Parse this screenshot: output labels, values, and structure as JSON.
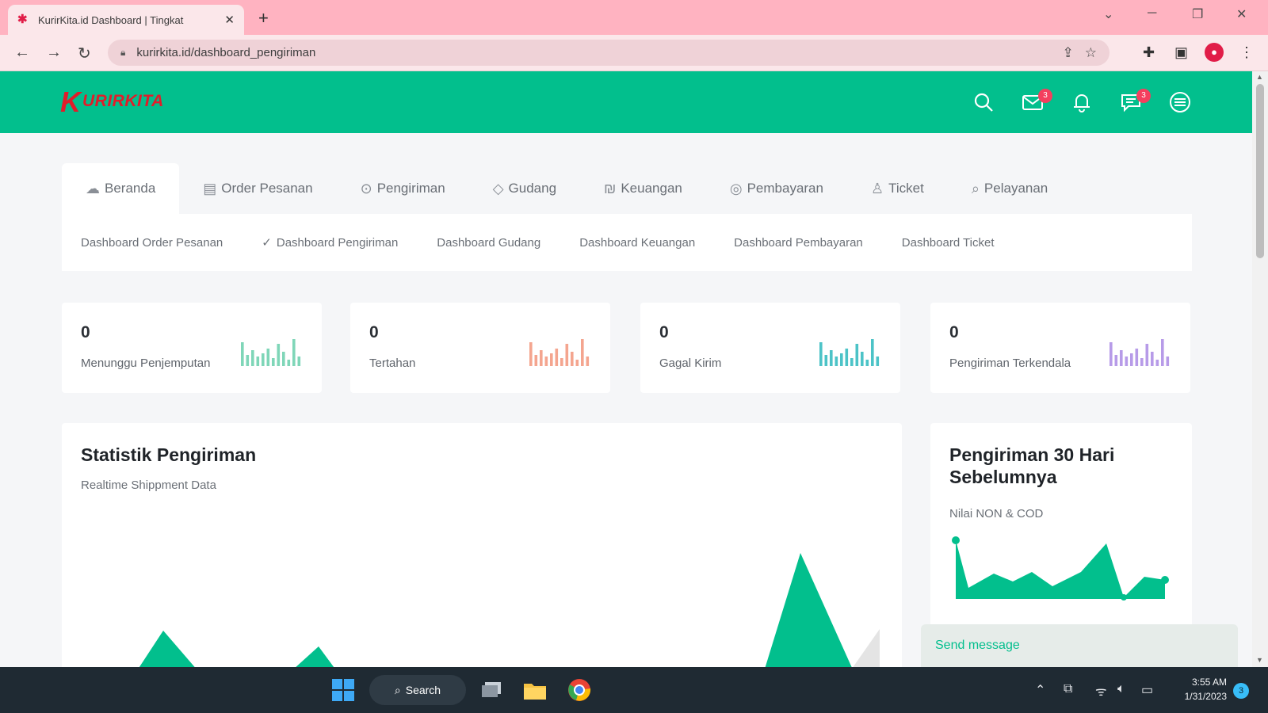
{
  "browser": {
    "tab_title": "KurirKita.id Dashboard | Tingkat",
    "tab_close": "✕",
    "new_tab": "+",
    "url": "kurirkita.id/dashboard_pengiriman",
    "window_controls": [
      "⌄",
      "─",
      "❐",
      "✕"
    ],
    "profile_initial": "●"
  },
  "app": {
    "logo_text": "URIRKITA",
    "logo_mark": "K",
    "header_icons": [
      {
        "icon": "search-icon"
      },
      {
        "icon": "mail-icon",
        "badge": "3"
      },
      {
        "icon": "bell-icon"
      },
      {
        "icon": "chat-icon",
        "badge": "3"
      },
      {
        "icon": "menu-icon"
      }
    ],
    "badges": {
      "mail": "3",
      "chat": "3"
    }
  },
  "main_tabs": [
    {
      "label": "Beranda",
      "icon": "cloud-icon",
      "glyph": "☁",
      "active": true
    },
    {
      "label": "Order Pesanan",
      "icon": "order-icon",
      "glyph": "▤",
      "active": false
    },
    {
      "label": "Pengiriman",
      "icon": "location-pin-icon",
      "glyph": "⊙",
      "active": false
    },
    {
      "label": "Gudang",
      "icon": "tag-icon",
      "glyph": "◇",
      "active": false
    },
    {
      "label": "Keuangan",
      "icon": "money-icon",
      "glyph": "₪",
      "active": false
    },
    {
      "label": "Pembayaran",
      "icon": "payment-icon",
      "glyph": "◎",
      "active": false
    },
    {
      "label": "Ticket",
      "icon": "ticket-icon",
      "glyph": "♙",
      "active": false
    },
    {
      "label": "Pelayanan",
      "icon": "search-service-icon",
      "glyph": "⌕",
      "active": false
    }
  ],
  "sub_nav": [
    {
      "label": "Dashboard Order Pesanan",
      "checked": false
    },
    {
      "label": "Dashboard Pengiriman",
      "checked": true
    },
    {
      "label": "Dashboard Gudang",
      "checked": false
    },
    {
      "label": "Dashboard Keuangan",
      "checked": false
    },
    {
      "label": "Dashboard Pembayaran",
      "checked": false
    },
    {
      "label": "Dashboard Ticket",
      "checked": false
    }
  ],
  "stats": [
    {
      "value": "0",
      "label": "Menunggu Penjemputan",
      "color": "#7fd6b8"
    },
    {
      "value": "0",
      "label": "Tertahan",
      "color": "#f4a58f"
    },
    {
      "value": "0",
      "label": "Gagal Kirim",
      "color": "#4cc3c7"
    },
    {
      "value": "0",
      "label": "Pengiriman Terkendala",
      "color": "#b79be8"
    }
  ],
  "statistik": {
    "title": "Statistik Pengiriman",
    "subtitle": "Realtime Shippment Data"
  },
  "pengiriman30": {
    "title": "Pengiriman 30 Hari Sebelumnya",
    "subtitle": "Nilai NON & COD"
  },
  "send_message": {
    "placeholder": "Send message"
  },
  "taskbar": {
    "search_label": "Search",
    "time": "3:55 AM",
    "date": "1/31/2023",
    "notification_count": "3"
  },
  "colors": {
    "brand": "#02bf8d",
    "logo": "#e11d2a",
    "badge": "#f43f5e"
  }
}
